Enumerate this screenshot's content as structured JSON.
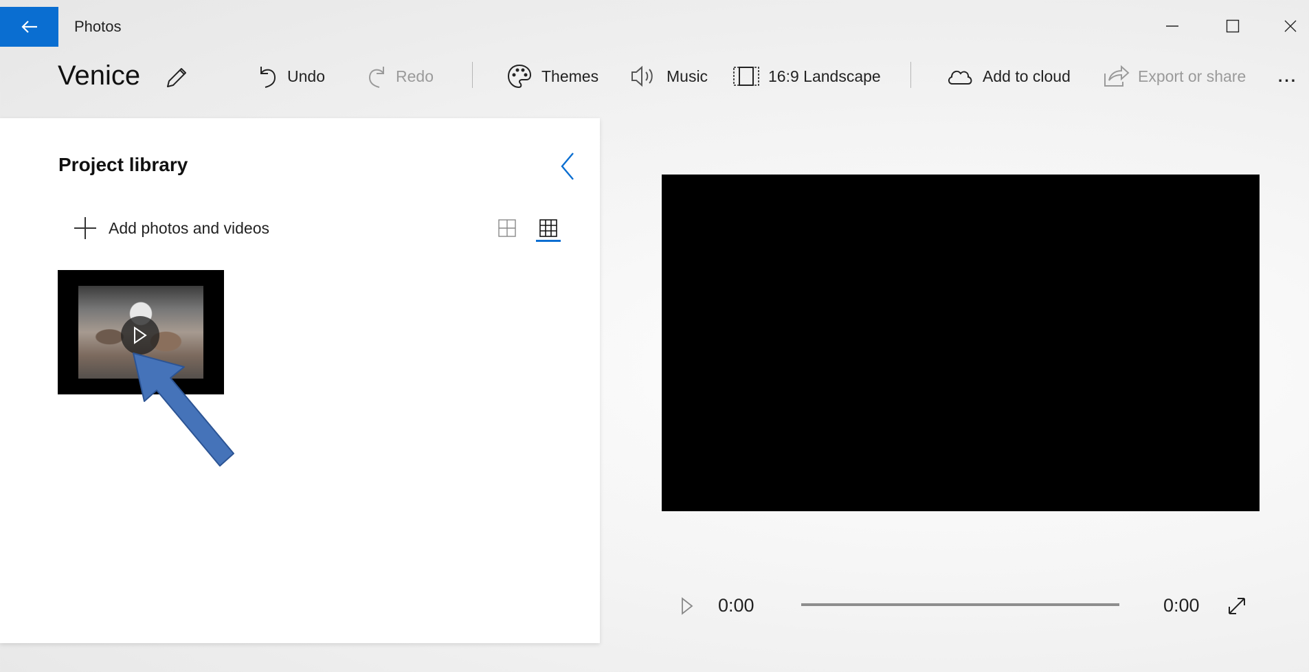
{
  "window": {
    "app_title": "Photos",
    "back_icon": "arrow-left-icon",
    "accent": "#0a6ed1"
  },
  "toolbar": {
    "project_title": "Venice",
    "undo_label": "Undo",
    "redo_label": "Redo",
    "themes_label": "Themes",
    "music_label": "Music",
    "aspect_label": "16:9 Landscape",
    "add_to_cloud_label": "Add to cloud",
    "export_label": "Export or share",
    "more_label": "..."
  },
  "library": {
    "title": "Project library",
    "add_label": "Add photos and videos",
    "items": [
      {
        "type": "video",
        "icon": "play-icon"
      }
    ]
  },
  "player": {
    "time_current": "0:00",
    "time_total": "0:00",
    "progress": 0
  }
}
